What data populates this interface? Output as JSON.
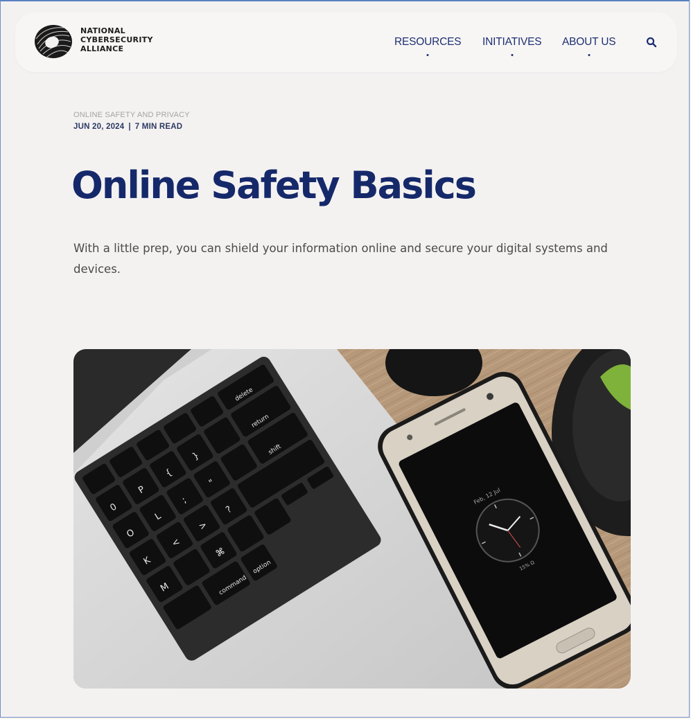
{
  "brand": {
    "line1": "NATIONAL",
    "line2": "CYBERSECURITY",
    "line3": "ALLIANCE",
    "logo_icon": "swirl-logo-icon"
  },
  "nav": {
    "items": [
      {
        "label": "RESOURCES"
      },
      {
        "label": "INITIATIVES"
      },
      {
        "label": "ABOUT US"
      }
    ],
    "search_icon": "search-icon"
  },
  "article": {
    "category": "ONLINE SAFETY AND PRIVACY",
    "date": "JUN 20, 2024",
    "separator": "|",
    "read_time": "7 MIN READ",
    "title": "Online Safety Basics",
    "intro": "With a little prep, you can shield your information online and secure your digital systems and devices."
  },
  "hero_image": {
    "description_icon": "laptop-and-smartphone-photo",
    "phone_date": "Feb, 12 Jul",
    "phone_batt": "15% Ω"
  },
  "colors": {
    "background": "#f4f2f1",
    "title": "#15296a",
    "nav": "#1d2f72",
    "wood": "#b89b7a"
  }
}
